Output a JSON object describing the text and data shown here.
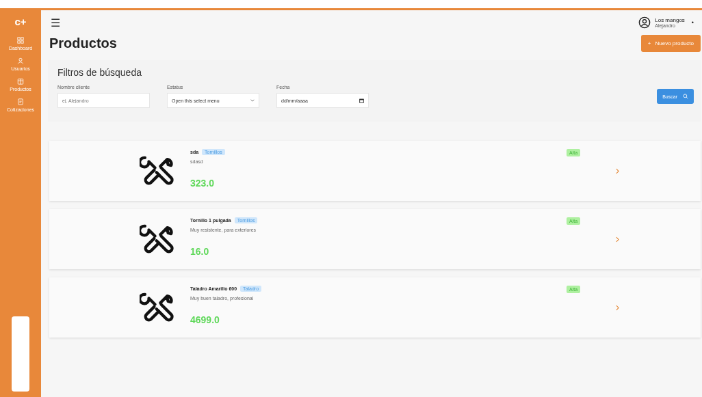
{
  "sidebar": {
    "logo": "c+",
    "items": [
      {
        "label": "Dashboard"
      },
      {
        "label": "Usuarios"
      },
      {
        "label": "Productos"
      },
      {
        "label": "Cotizaciones"
      }
    ]
  },
  "header": {
    "menu_icon": "☰",
    "user": {
      "name": "Los mangos",
      "subtitle": "Alejandro",
      "caret": "•"
    }
  },
  "page": {
    "title": "Productos",
    "new_button": "Nuevo producto",
    "new_button_icon": "+"
  },
  "filters": {
    "title": "Filtros de búsqueda",
    "fields": [
      {
        "kind": "text",
        "label": "Nombre cliente",
        "placeholder": "ej. Alejandro"
      },
      {
        "kind": "select",
        "label": "Estatus",
        "value": "Open this select menu"
      },
      {
        "kind": "date",
        "label": "Fecha",
        "value": "dd/mm/aaaa"
      }
    ],
    "search_button": "Buscar"
  },
  "products": [
    {
      "name": "sda",
      "tag": "Tornillos",
      "description": "sdasd",
      "price": "323.0",
      "badge": "Alta"
    },
    {
      "name": "Tornillo 1 pulgada",
      "tag": "Tornillos",
      "description": "Muy resistente, para exteriores",
      "price": "16.0",
      "badge": "Alta"
    },
    {
      "name": "Taladro Amarillo 600",
      "tag": "Taladro",
      "description": "Muy buen taladro, profesional",
      "price": "4699.0",
      "badge": "Alta"
    }
  ]
}
